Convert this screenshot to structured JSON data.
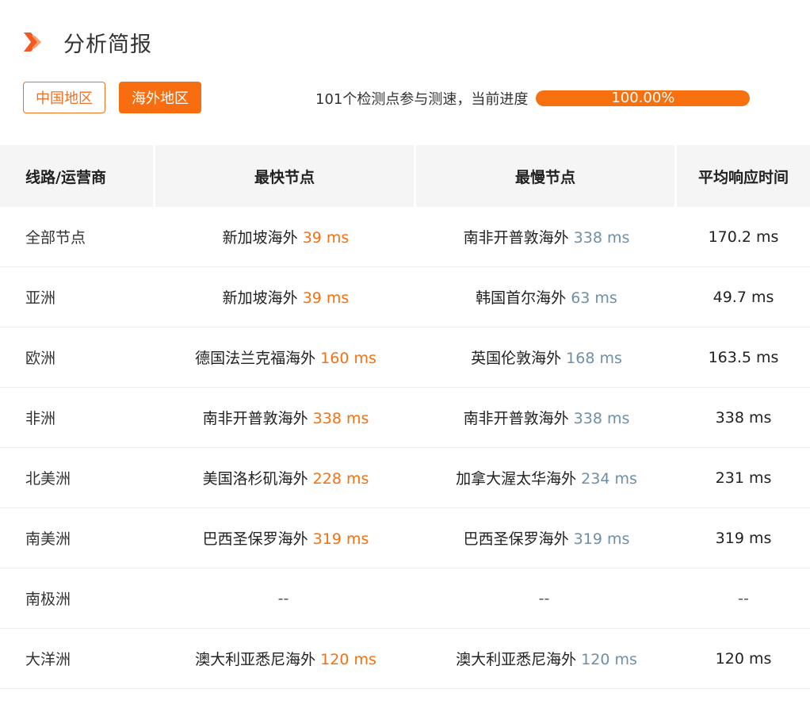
{
  "header": {
    "title": "分析简报",
    "icon": "double-chevron-right-icon",
    "accent_color": "#f25a24"
  },
  "tabs": [
    {
      "label": "中国地区",
      "active": false
    },
    {
      "label": "海外地区",
      "active": true
    }
  ],
  "progress": {
    "text": "101个检测点参与测速，当前进度",
    "value_label": "100.00%",
    "value": 100,
    "color": "#f7700f"
  },
  "table": {
    "headers": [
      "线路/运营商",
      "最快节点",
      "最慢节点",
      "平均响应时间"
    ],
    "rows": [
      {
        "region": "全部节点",
        "fast_node": "新加坡海外",
        "fast_ms": "39 ms",
        "slow_node": "南非开普敦海外",
        "slow_ms": "338 ms",
        "avg": "170.2 ms"
      },
      {
        "region": "亚洲",
        "fast_node": "新加坡海外",
        "fast_ms": "39 ms",
        "slow_node": "韩国首尔海外",
        "slow_ms": "63 ms",
        "avg": "49.7 ms"
      },
      {
        "region": "欧洲",
        "fast_node": "德国法兰克福海外",
        "fast_ms": "160 ms",
        "slow_node": "英国伦敦海外",
        "slow_ms": "168 ms",
        "avg": "163.5 ms"
      },
      {
        "region": "非洲",
        "fast_node": "南非开普敦海外",
        "fast_ms": "338 ms",
        "slow_node": "南非开普敦海外",
        "slow_ms": "338 ms",
        "avg": "338 ms"
      },
      {
        "region": "北美洲",
        "fast_node": "美国洛杉矶海外",
        "fast_ms": "228 ms",
        "slow_node": "加拿大渥太华海外",
        "slow_ms": "234 ms",
        "avg": "231 ms"
      },
      {
        "region": "南美洲",
        "fast_node": "巴西圣保罗海外",
        "fast_ms": "319 ms",
        "slow_node": "巴西圣保罗海外",
        "slow_ms": "319 ms",
        "avg": "319 ms"
      },
      {
        "region": "南极洲",
        "fast_node": "--",
        "fast_ms": "",
        "slow_node": "--",
        "slow_ms": "",
        "avg": "--"
      },
      {
        "region": "大洋洲",
        "fast_node": "澳大利亚悉尼海外",
        "fast_ms": "120 ms",
        "slow_node": "澳大利亚悉尼海外",
        "slow_ms": "120 ms",
        "avg": "120 ms"
      }
    ]
  }
}
